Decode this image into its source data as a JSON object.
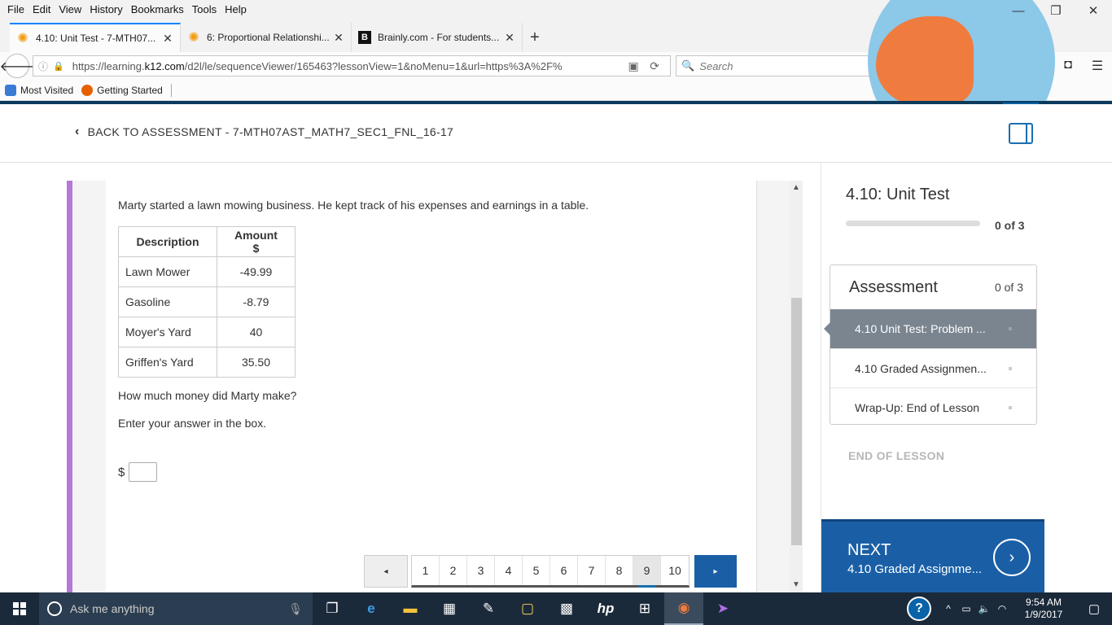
{
  "menubar": {
    "items": [
      "File",
      "Edit",
      "View",
      "History",
      "Bookmarks",
      "Tools",
      "Help"
    ]
  },
  "window_controls": [
    "—",
    "❐",
    "✕"
  ],
  "tabs": [
    {
      "title": "4.10: Unit Test - 7-MTH07...",
      "icon": "flower-icon",
      "active": true
    },
    {
      "title": "6: Proportional Relationshi...",
      "icon": "flower-icon",
      "active": false
    },
    {
      "title": "Brainly.com - For students...",
      "icon": "brainly-icon",
      "active": false
    }
  ],
  "tab_close": "✕",
  "new_tab": "+",
  "nav": {
    "url_prefix": "https://learning.",
    "url_domain": "k12.com",
    "url_rest": "/d2l/le/sequenceViewer/165463?lessonView=1&noMenu=1&url=https%3A%2F%",
    "search_placeholder": "Search"
  },
  "bookmarks": [
    "Most Visited",
    "Getting Started"
  ],
  "page": {
    "back_label": "BACK TO ASSESSMENT - 7-MTH07AST_MATH7_SEC1_FNL_16-17"
  },
  "question": {
    "intro": "Marty started a lawn mowing business. He kept track of his expenses and earnings in a table.",
    "table_headers": [
      "Description",
      "Amount $"
    ],
    "rows": [
      {
        "desc": "Lawn Mower",
        "amount": "-49.99"
      },
      {
        "desc": "Gasoline",
        "amount": "-8.79"
      },
      {
        "desc": "Moyer's Yard",
        "amount": "40"
      },
      {
        "desc": "Griffen's Yard",
        "amount": "35.50"
      }
    ],
    "ask": "How much money did Marty make?",
    "instruction": "Enter your answer in the box.",
    "currency": "$",
    "answer_value": ""
  },
  "pager": {
    "pages": [
      "1",
      "2",
      "3",
      "4",
      "5",
      "6",
      "7",
      "8",
      "9",
      "10"
    ],
    "current": "9",
    "prev": "◂",
    "next": "▸"
  },
  "sidebar": {
    "title": "4.10: Unit Test",
    "progress_count": "0 of 3",
    "progress_fraction": 0,
    "card_title": "Assessment",
    "card_count": "0 of 3",
    "items": [
      {
        "label": "4.10 Unit Test: Problem ...",
        "active": true
      },
      {
        "label": "4.10 Graded Assignmen...",
        "active": false
      },
      {
        "label": "Wrap-Up: End of Lesson",
        "active": false
      }
    ],
    "end_label": "END OF LESSON",
    "next_label": "NEXT",
    "next_sub": "4.10 Graded Assignme..."
  },
  "taskbar": {
    "search_placeholder": "Ask me anything",
    "time": "9:54 AM",
    "date": "1/9/2017"
  },
  "colors": {
    "accent": "#1a5fa6",
    "question_accent": "#b678d6",
    "taskbar": "#1b2a3a"
  }
}
